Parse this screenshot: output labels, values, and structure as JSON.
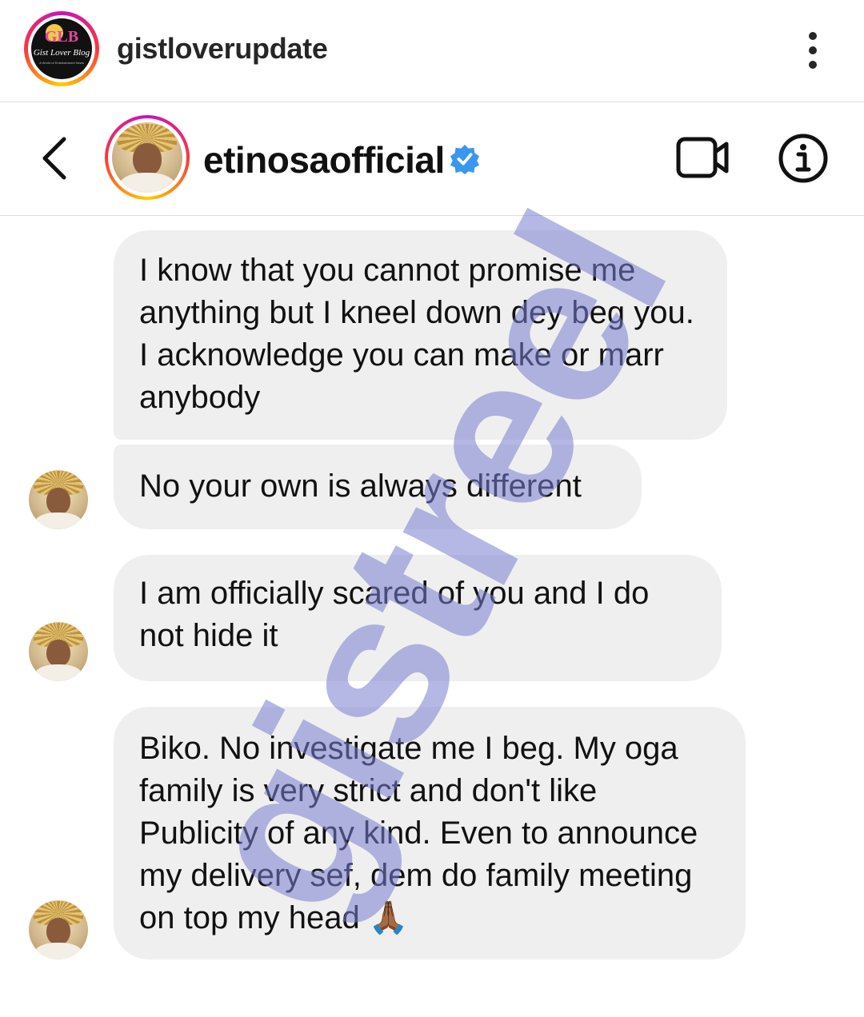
{
  "post": {
    "username": "gistloverupdate",
    "logo": {
      "mark": "GLB",
      "name": "Gist Lover Blog",
      "tagline": "A World of Entertainment News"
    }
  },
  "dm": {
    "username": "etinosaofficial",
    "verified": true
  },
  "messages": [
    {
      "text": "I know that you cannot promise me anything but I kneel down dey beg you. I acknowledge you can make or marr anybody",
      "show_avatar": false
    },
    {
      "text": "No your own is always different",
      "show_avatar": true
    },
    {
      "text": "I am officially scared of you and I do not hide it",
      "show_avatar": true
    },
    {
      "text": "Biko. No investigate me I beg. My oga family is very strict and don't like Publicity of any kind. Even to announce my delivery sef, dem do family meeting on top my head 🙏🏾",
      "show_avatar": true
    }
  ],
  "watermark": "gistreel",
  "icons": {
    "more": "more-vertical-icon",
    "back": "chevron-left-icon",
    "verified": "verified-badge-icon",
    "video": "video-call-icon",
    "info": "info-icon"
  },
  "colors": {
    "verified": "#3897f0",
    "bubble": "#efefef",
    "watermark": "#787dcd",
    "story_ring": [
      "#c913b9",
      "#f9373f",
      "#fecd00"
    ]
  }
}
